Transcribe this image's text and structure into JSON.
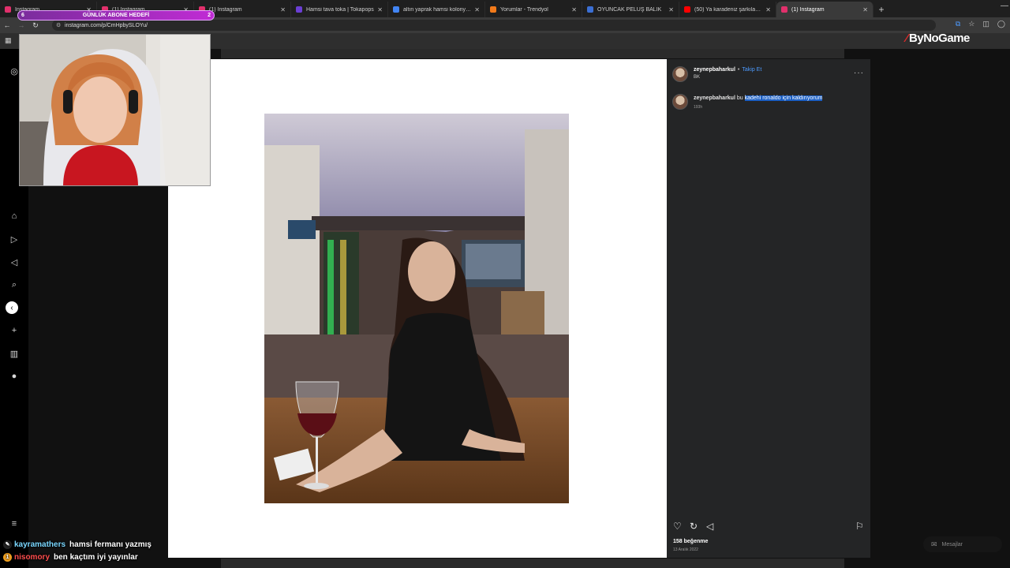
{
  "browser": {
    "tabs": [
      {
        "label": "Instagram",
        "fav": "#e1306c",
        "active": false
      },
      {
        "label": "(1) Instagram",
        "fav": "#e1306c",
        "active": false
      },
      {
        "label": "(1) Instagram",
        "fav": "#e1306c",
        "active": false
      },
      {
        "label": "Hamsi tava toka | Tokapops",
        "fav": "#6b3fd4",
        "active": false
      },
      {
        "label": "altın yaprak hamsi kolonyası - G",
        "fav": "#4285f4",
        "active": false
      },
      {
        "label": "Yorumlar - Trendyol",
        "fav": "#f27a1a",
        "active": false
      },
      {
        "label": "OYUNCAK PELUŞ BALIK",
        "fav": "#3b6fd4",
        "active": false
      },
      {
        "label": "(50) Ya karadeniz şarkıları çok s",
        "fav": "#ff0000",
        "active": false
      },
      {
        "label": "(1) Instagram",
        "fav": "#e1306c",
        "active": true
      }
    ],
    "url": "instagram.com/p/CmHpbySLOYu/"
  },
  "overlay": {
    "sub_goal_left": "6",
    "sub_goal_label": "GÜNLÜK ABONE HEDEFİ",
    "sub_goal_right": "2",
    "brand": "ByNoGame"
  },
  "post": {
    "username": "zeynepbaharkul",
    "follow_label": "Takip Et",
    "sub_label": "BK",
    "caption_username": "zeynepbaharkul",
    "caption_plain": "bu",
    "caption_highlight": "kadehi ronaldo için kaldırıyorum",
    "caption_time": "193h",
    "likes": "158 beğenme",
    "date": "13 Aralık 2022"
  },
  "messages_label": "Mesajlar",
  "chat": [
    {
      "user": "kayramathers",
      "message": "hamsi fermanı yazmış",
      "user_color": "#7ad7ff",
      "badge_color": "#222",
      "badge": "✎"
    },
    {
      "user": "nisomory",
      "message": "ben kaçtım iyi yayınlar",
      "user_color": "#ff4d4d",
      "badge_color": "#f0a020",
      "badge": "1"
    }
  ]
}
